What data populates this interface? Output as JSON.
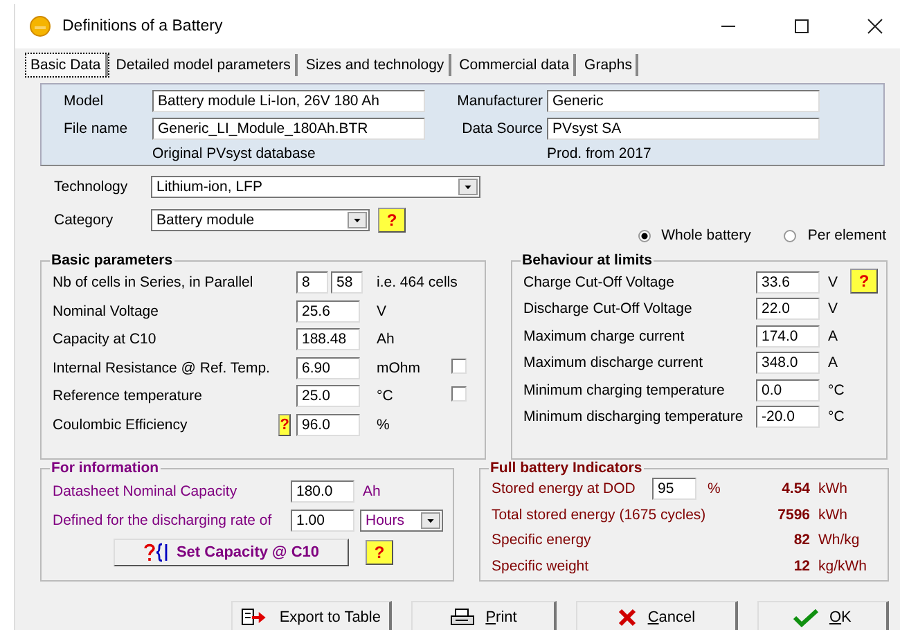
{
  "window": {
    "title": "Definitions of a Battery"
  },
  "tabs": [
    {
      "label": "Basic Data",
      "selected": true
    },
    {
      "label": "Detailed model parameters",
      "selected": false
    },
    {
      "label": "Sizes and technology",
      "selected": false
    },
    {
      "label": "Commercial data",
      "selected": false
    },
    {
      "label": "Graphs",
      "selected": false
    }
  ],
  "identity": {
    "fields": [
      {
        "label": "Model",
        "value": "Battery module Li-Ion, 26V 180 Ah"
      },
      {
        "label": "Manufacturer",
        "value": "Generic"
      },
      {
        "label": "File name",
        "value": "Generic_LI_Module_180Ah.BTR"
      },
      {
        "label": "Data Source",
        "value": "PVsyst SA"
      }
    ],
    "notes": [
      "Original PVsyst database",
      "Prod. from 2017"
    ]
  },
  "technology": {
    "label": "Technology",
    "value": "Lithium-ion, LFP"
  },
  "category": {
    "label": "Category",
    "value": "Battery module",
    "help": "?"
  },
  "scope": [
    {
      "label": "Whole battery",
      "selected": true
    },
    {
      "label": "Per element",
      "selected": false
    }
  ],
  "basic_parameters": {
    "title": "Basic parameters",
    "rows": [
      {
        "label": "Nb of cells in Series, in Parallel",
        "values": [
          "8",
          "58"
        ],
        "unit": "i.e. 464 cells"
      },
      {
        "label": "Nominal Voltage",
        "values": [
          "25.6"
        ],
        "unit": "V"
      },
      {
        "label": "Capacity at C10",
        "values": [
          "188.48"
        ],
        "unit": "Ah"
      },
      {
        "label": "Internal Resistance @ Ref. Temp.",
        "values": [
          "6.90"
        ],
        "unit": "mOhm",
        "checked": false
      },
      {
        "label": "Reference temperature",
        "values": [
          "25.0"
        ],
        "unit": "°C",
        "checked": false
      },
      {
        "label": "Coulombic Efficiency",
        "values": [
          "96.0"
        ],
        "unit": "%",
        "help": "?"
      }
    ]
  },
  "limits": {
    "title": "Behaviour at limits",
    "help": "?",
    "rows": [
      {
        "label": "Charge Cut-Off Voltage",
        "value": "33.6",
        "unit": "V"
      },
      {
        "label": "Discharge Cut-Off Voltage",
        "value": "22.0",
        "unit": "V"
      },
      {
        "label": "Maximum charge current",
        "value": "174.0",
        "unit": "A"
      },
      {
        "label": "Maximum discharge current",
        "value": "348.0",
        "unit": "A"
      },
      {
        "label": "Minimum charging temperature",
        "value": "0.0",
        "unit": "°C"
      },
      {
        "label": "Minimum discharging temperature",
        "value": "-20.0",
        "unit": "°C"
      }
    ]
  },
  "information": {
    "title": "For information",
    "capacity": {
      "label": "Datasheet Nominal Capacity",
      "value": "180.0",
      "unit": "Ah"
    },
    "rate": {
      "label": "Defined for the discharging rate of",
      "value": "1.00",
      "unit": "Hours"
    },
    "button": "Set Capacity @ C10",
    "help": "?"
  },
  "indicators": {
    "title": "Full battery Indicators",
    "rows": [
      {
        "label": "Stored energy at DOD",
        "input": "95",
        "input_unit": "%",
        "value": "4.54",
        "unit": "kWh"
      },
      {
        "label": "Total stored energy (1675 cycles)",
        "value": "7596",
        "unit": "kWh"
      },
      {
        "label": "Specific energy",
        "value": "82",
        "unit": "Wh/kg"
      },
      {
        "label": "Specific weight",
        "value": "12",
        "unit": "kg/kWh"
      }
    ]
  },
  "buttons": [
    {
      "kind": "export",
      "label": "Export to Table"
    },
    {
      "kind": "print",
      "label": "Print"
    },
    {
      "kind": "cancel",
      "label": "Cancel"
    },
    {
      "kind": "ok",
      "label": "OK"
    }
  ]
}
